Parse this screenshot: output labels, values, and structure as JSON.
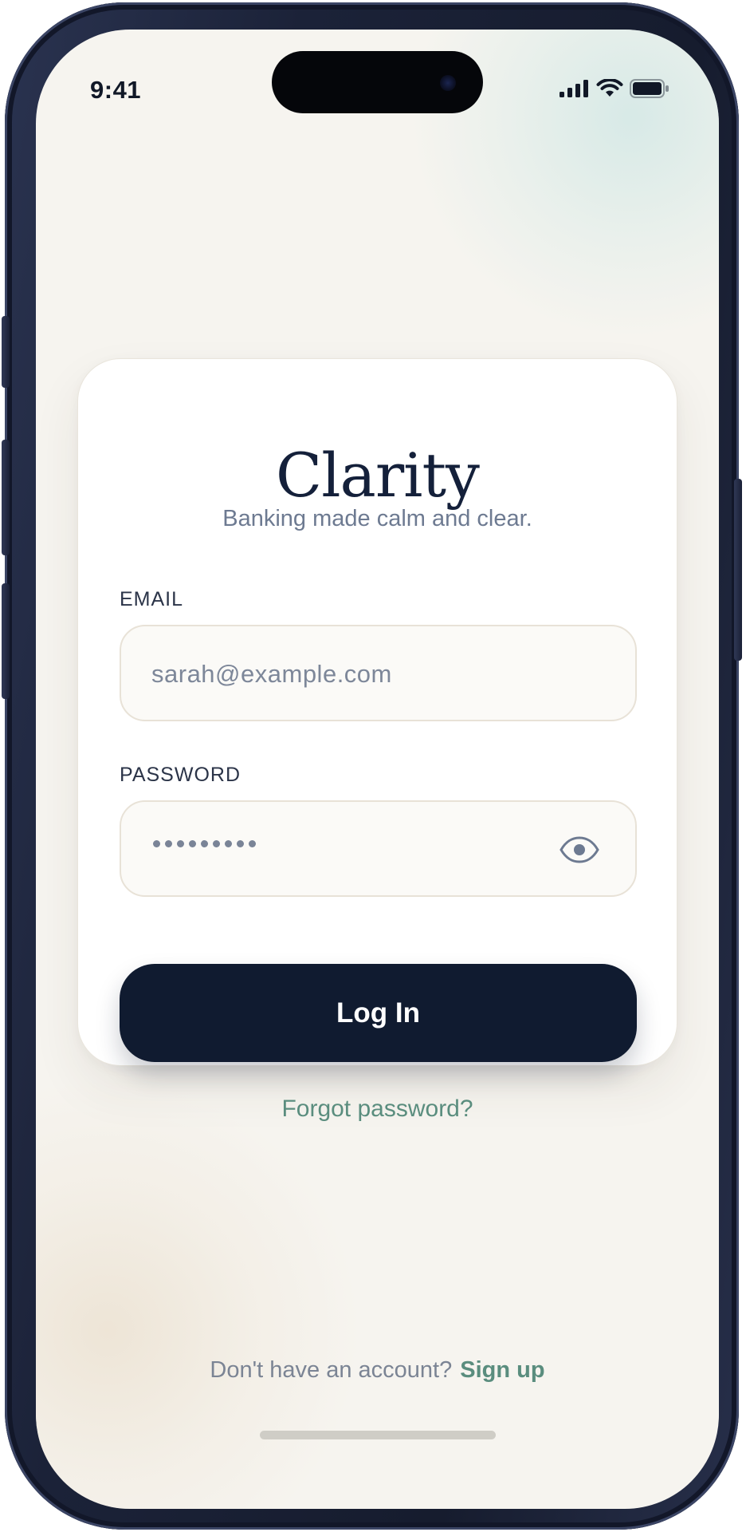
{
  "status_bar": {
    "time": "9:41",
    "icons": [
      "cellular-signal-icon",
      "wifi-icon",
      "battery-icon"
    ]
  },
  "app": {
    "name": "Clarity",
    "tagline": "Banking made calm and clear."
  },
  "form": {
    "email_label": "EMAIL",
    "email_placeholder": "sarah@example.com",
    "password_label": "PASSWORD",
    "password_mask_length": 9,
    "show_password_icon": "eye-icon",
    "login_label": "Log In"
  },
  "links": {
    "forgot_password": "Forgot password?",
    "no_account_prompt": "Don't have an account?",
    "sign_up": "Sign up"
  },
  "colors": {
    "background": "#f6f4ef",
    "primary_navy": "#101b30",
    "accent_green": "#5a8d7e",
    "muted_text": "#6d7a91"
  }
}
